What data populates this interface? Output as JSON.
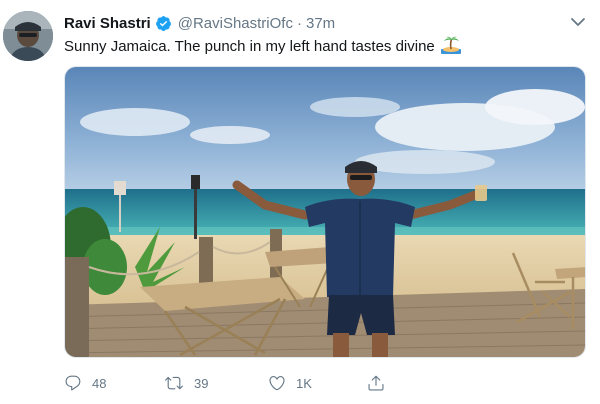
{
  "author": {
    "display_name": "Ravi Shastri",
    "verified": true,
    "handle": "@RaviShastriOfc",
    "separator": "·",
    "time": "37m"
  },
  "tweet": {
    "text": "Sunny Jamaica. The punch in my left hand tastes divine",
    "emoji": "desert-island-emoji"
  },
  "actions": {
    "reply_count": "48",
    "retweet_count": "39",
    "like_count": "1K"
  },
  "colors": {
    "text_primary": "#14171a",
    "text_secondary": "#657786",
    "verified_blue": "#1da1f2"
  },
  "icons": [
    "chevron-down-icon",
    "verified-badge-icon",
    "reply-icon",
    "retweet-icon",
    "like-icon",
    "share-icon"
  ]
}
